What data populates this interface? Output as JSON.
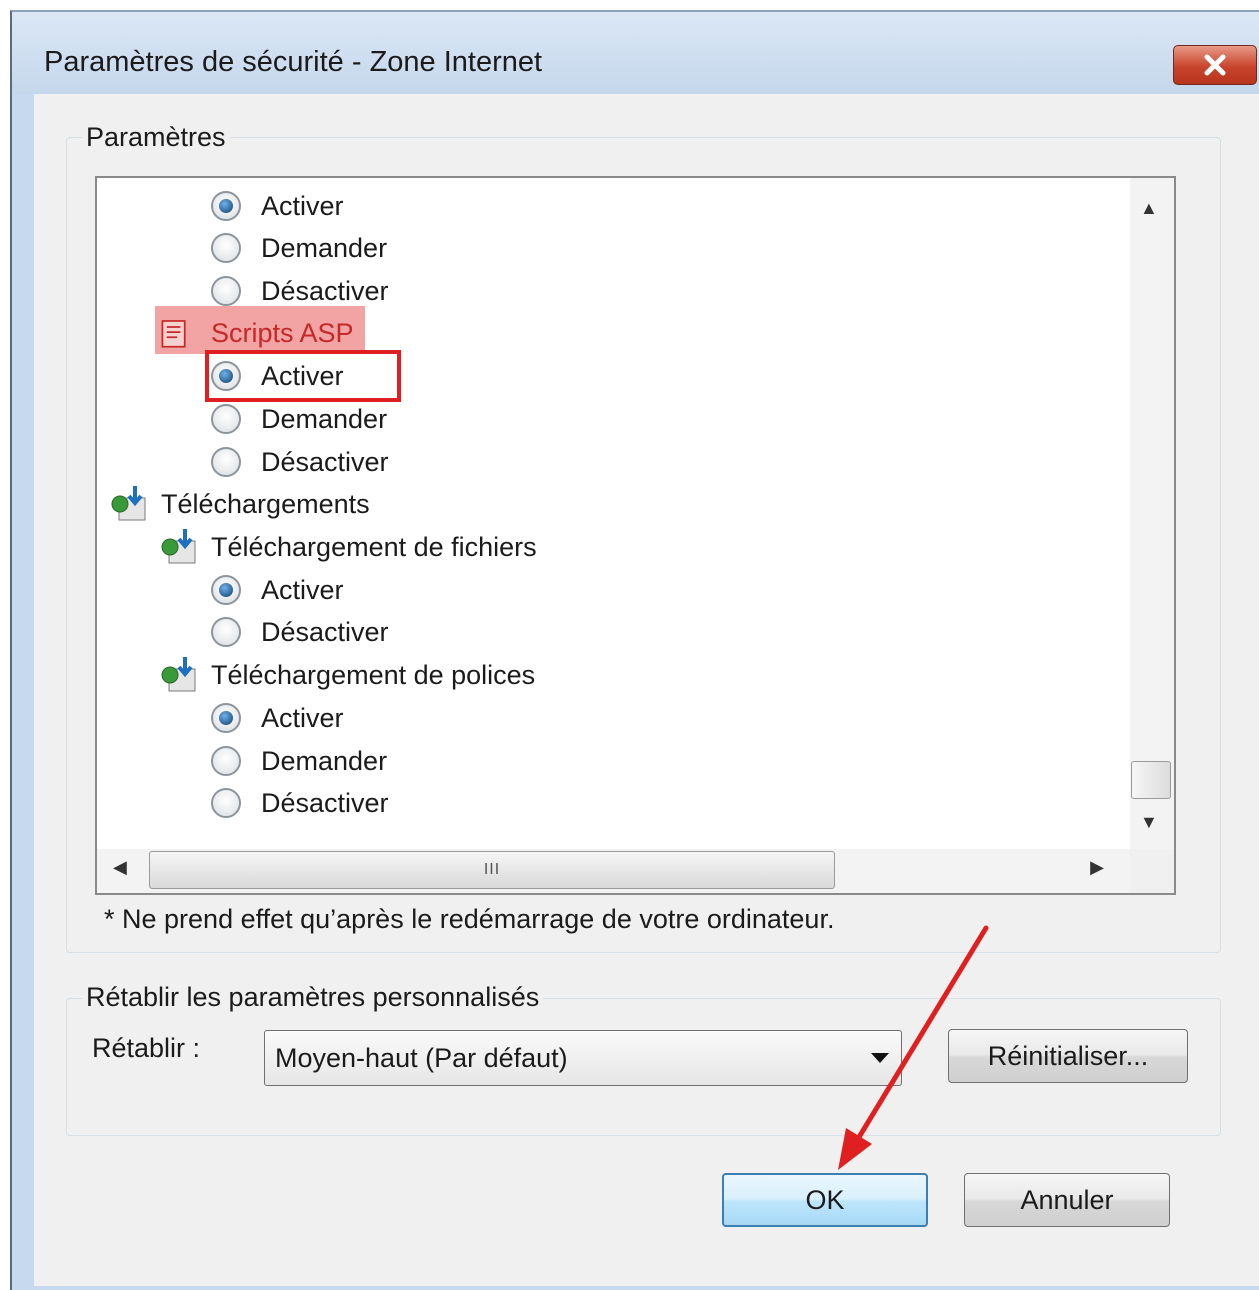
{
  "window": {
    "title": "Paramètres de sécurité - Zone Internet"
  },
  "settings_group": {
    "legend": "Paramètres",
    "tree": {
      "r1": "Activer",
      "r2": "Demander",
      "r3": "Désactiver",
      "scripts_asp": "Scripts ASP",
      "asp_activer": "Activer",
      "asp_demander": "Demander",
      "asp_desactiver": "Désactiver",
      "telechargements": "Téléchargements",
      "fichiers": "Téléchargement de fichiers",
      "fichiers_activer": "Activer",
      "fichiers_desactiver": "Désactiver",
      "polices": "Téléchargement de polices",
      "polices_activer": "Activer",
      "polices_demander": "Demander",
      "polices_desactiver": "Désactiver"
    },
    "hscroll_grip": "III",
    "note": "* Ne prend effet qu’après le redémarrage de votre ordinateur."
  },
  "reset_group": {
    "legend": "Rétablir les paramètres personnalisés",
    "label": "Rétablir :",
    "selected_value": "Moyen-haut (Par défaut)",
    "reset_button": "Réinitialiser..."
  },
  "buttons": {
    "ok": "OK",
    "cancel": "Annuler"
  },
  "colors": {
    "highlight": "#f2a3a3",
    "annotation_red": "#e02020",
    "close_button": "#c9442c"
  }
}
